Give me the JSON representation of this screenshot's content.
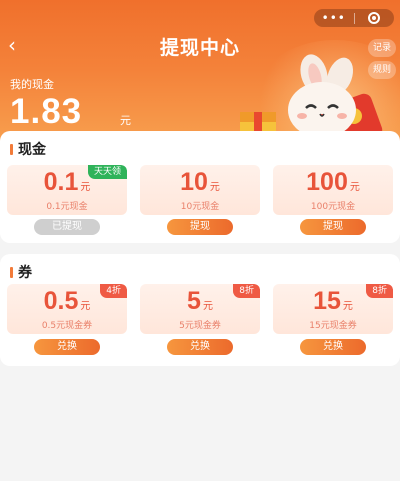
{
  "header": {
    "title": "提现中心",
    "back_icon": "back-arrow-icon",
    "capsule": {
      "more": "•••",
      "close_icon": "target-icon"
    },
    "record_label": "记录",
    "rule_label": "规则"
  },
  "balance": {
    "label": "我的现金",
    "amount": "1.83",
    "unit": "元"
  },
  "cash_section": {
    "title": "现金",
    "items": [
      {
        "amount": "0.1",
        "unit": "元",
        "desc": "0.1元现金",
        "badge": "天天领",
        "button": "已提现",
        "button_state": "disabled"
      },
      {
        "amount": "10",
        "unit": "元",
        "desc": "10元现金",
        "badge": "",
        "button": "提现",
        "button_state": "active"
      },
      {
        "amount": "100",
        "unit": "元",
        "desc": "100元现金",
        "badge": "",
        "button": "提现",
        "button_state": "active"
      }
    ]
  },
  "coupon_section": {
    "title": "券",
    "items": [
      {
        "amount": "0.5",
        "unit": "元",
        "desc": "0.5元现金券",
        "badge": "4折",
        "button": "兑换"
      },
      {
        "amount": "5",
        "unit": "元",
        "desc": "5元现金券",
        "badge": "8折",
        "button": "兑换"
      },
      {
        "amount": "15",
        "unit": "元",
        "desc": "15元现金券",
        "badge": "8折",
        "button": "兑换"
      }
    ]
  },
  "colors": {
    "hero_top": "#f0702c",
    "accent_red": "#e8543a",
    "badge_green": "#2fb35a",
    "badge_red": "#ef5a44",
    "button_orange": "#ec6a2c"
  }
}
